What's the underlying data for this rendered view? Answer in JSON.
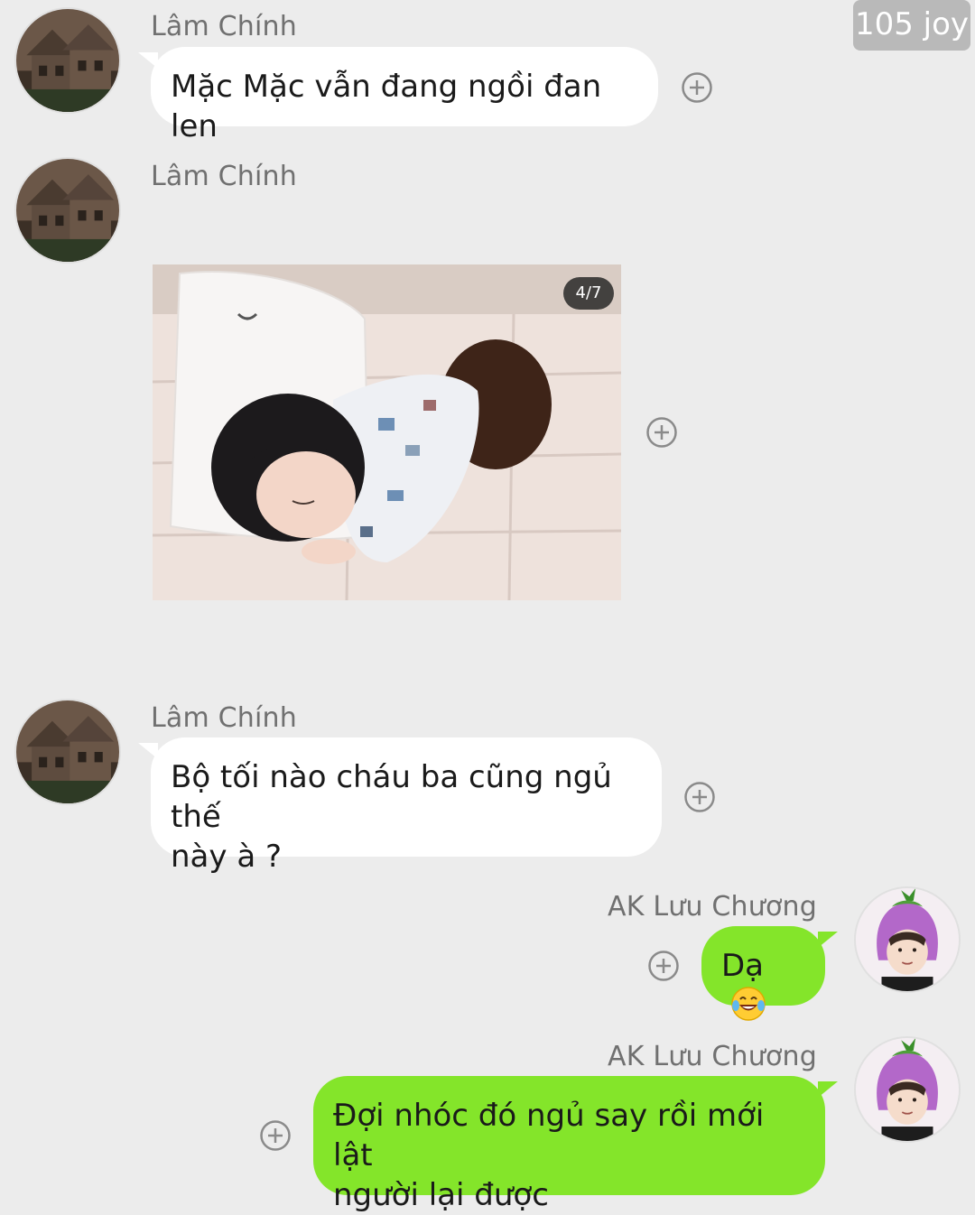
{
  "badge": {
    "text": "105 joy"
  },
  "messages": [
    {
      "sender": "Lâm Chính",
      "text": "Mặc Mặc vẫn đang ngồi đan len"
    },
    {
      "sender": "Lâm Chính",
      "photo_counter": "4/7"
    },
    {
      "sender": "Lâm Chính",
      "text_line1": "Bộ tối nào cháu ba cũng ngủ thế",
      "text_line2": "này à ?"
    },
    {
      "sender": "AK Lưu Chương",
      "text": "Dạ"
    },
    {
      "sender": "AK Lưu Chương",
      "text_line1": "Đợi nhóc đó ngủ say rồi mới lật",
      "text_line2": "người lại được"
    }
  ],
  "icons": {
    "add": "plus-circle-icon",
    "emoji": "laughing-tears-emoji-icon",
    "avatar_in": "house-avatar",
    "avatar_out": "eggplant-hat-avatar"
  },
  "colors": {
    "background": "#ececec",
    "incoming_bubble": "#ffffff",
    "outgoing_bubble": "#84e52a",
    "sender_name": "#707070"
  }
}
